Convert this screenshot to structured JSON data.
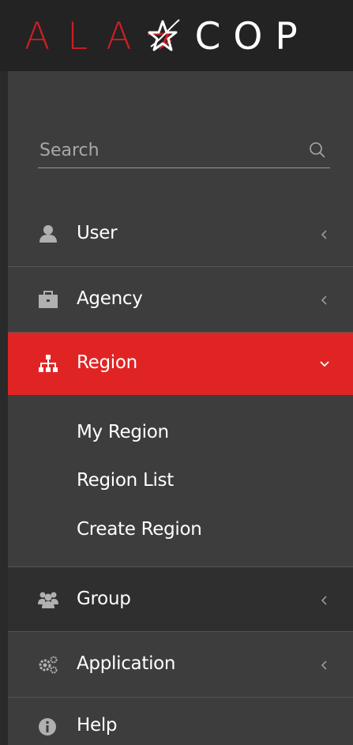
{
  "app": {
    "logo_left": "ALA",
    "logo_right": "COP",
    "brand_red": "#c81f24",
    "active_red": "#e02424"
  },
  "search": {
    "placeholder": "Search",
    "value": ""
  },
  "menu": {
    "user": {
      "label": "User",
      "icon": "user-icon"
    },
    "agency": {
      "label": "Agency",
      "icon": "briefcase-icon"
    },
    "region": {
      "label": "Region",
      "icon": "sitemap-icon",
      "expanded": true
    },
    "group": {
      "label": "Group",
      "icon": "users-icon"
    },
    "application": {
      "label": "Application",
      "icon": "gears-icon"
    },
    "help": {
      "label": "Help",
      "icon": "info-icon"
    }
  },
  "submenu": {
    "items": [
      "My Region",
      "Region List",
      "Create Region"
    ]
  }
}
